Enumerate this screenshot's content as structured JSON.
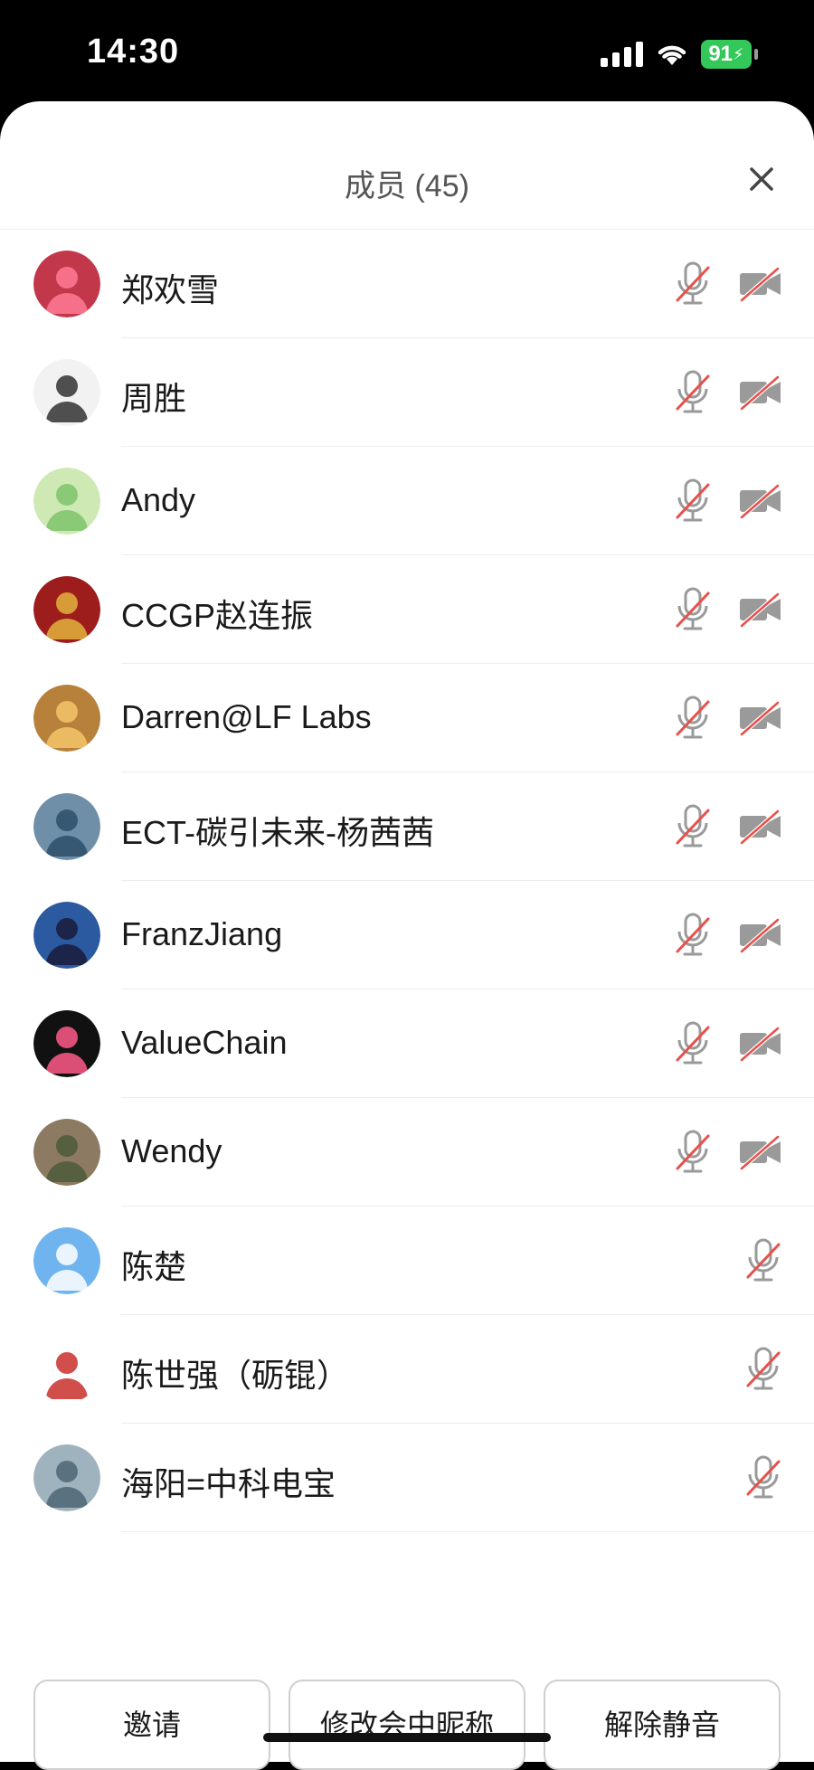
{
  "status_bar": {
    "time": "14:30",
    "battery_level": "91",
    "icons": [
      "cellular-signal-icon",
      "wifi-icon",
      "battery-charging-icon"
    ]
  },
  "sheet": {
    "title": "成员 (45)",
    "close_icon": "close-icon"
  },
  "members": [
    {
      "name": "郑欢雪",
      "mic": "muted",
      "camera": "off"
    },
    {
      "name": "周胜",
      "mic": "muted",
      "camera": "off"
    },
    {
      "name": "Andy",
      "mic": "muted",
      "camera": "off"
    },
    {
      "name": "CCGP赵连振",
      "mic": "muted",
      "camera": "off"
    },
    {
      "name": "Darren@LF Labs",
      "mic": "muted",
      "camera": "off"
    },
    {
      "name": "ECT-碳引未来-杨茜茜",
      "mic": "muted",
      "camera": "off"
    },
    {
      "name": "FranzJiang",
      "mic": "muted",
      "camera": "off"
    },
    {
      "name": "ValueChain",
      "mic": "muted",
      "camera": "off"
    },
    {
      "name": "Wendy",
      "mic": "muted",
      "camera": "off"
    },
    {
      "name": "陈楚",
      "mic": "muted",
      "camera": "none"
    },
    {
      "name": "陈世强（砺锟）",
      "mic": "muted",
      "camera": "none"
    },
    {
      "name": "海阳=中科电宝",
      "mic": "muted",
      "camera": "none"
    }
  ],
  "actions": {
    "invite": "邀请",
    "rename": "修改会中昵称",
    "unmute": "解除静音"
  },
  "colors": {
    "mute_slash": "#e8504a",
    "icon_gray": "#9a9a9a",
    "battery_green": "#34c759",
    "text_primary": "#1a1a1a"
  }
}
